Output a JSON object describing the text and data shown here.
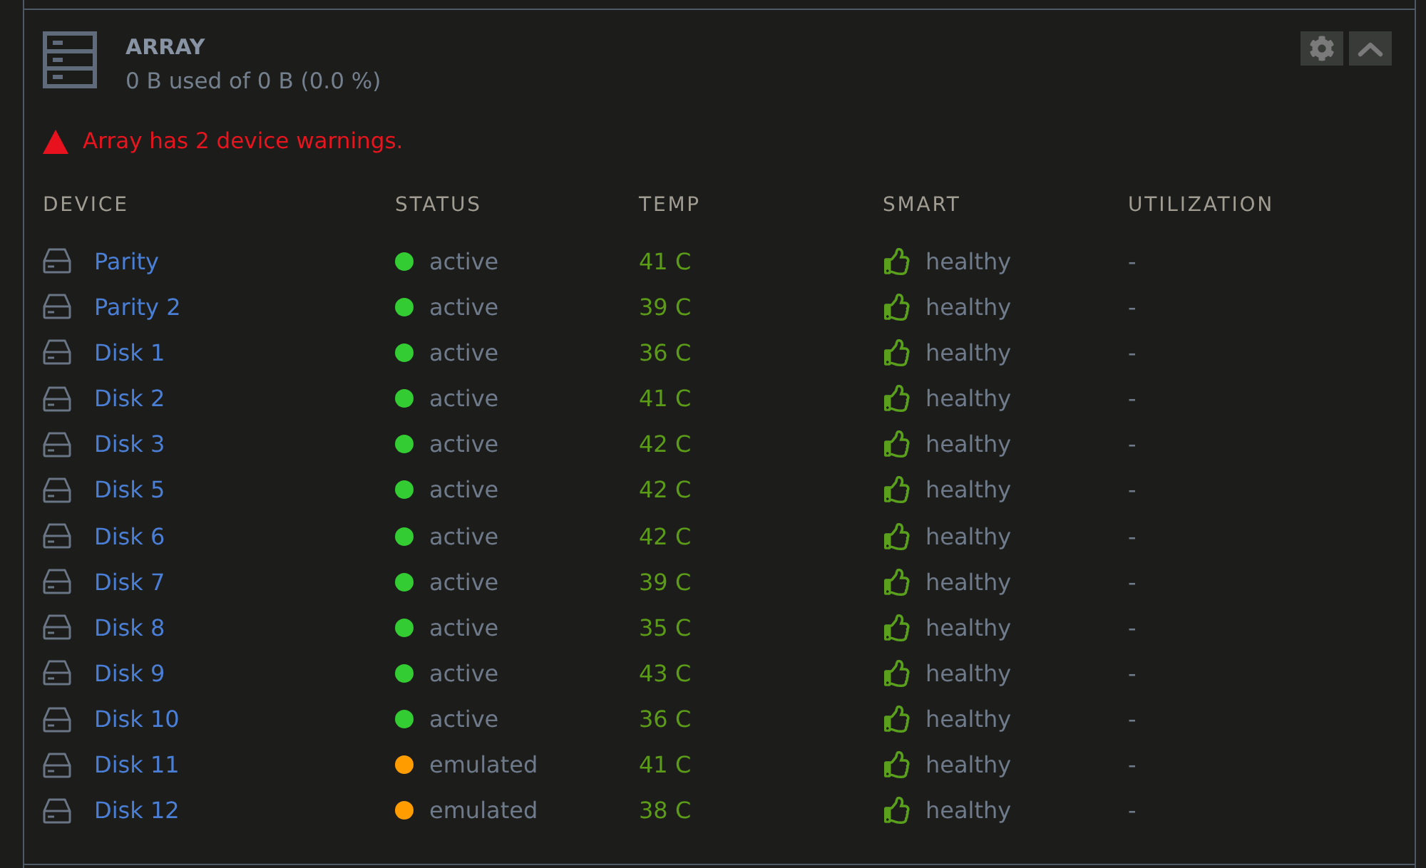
{
  "panel": {
    "title": "ARRAY",
    "usage": "0 B used of 0 B (0.0 %)",
    "warning": "Array has 2 device warnings."
  },
  "table": {
    "columns": [
      "DEVICE",
      "STATUS",
      "TEMP",
      "SMART",
      "UTILIZATION"
    ],
    "rows": [
      {
        "device": "Parity",
        "status": "active",
        "color": "#33cc33",
        "temp": "41 C",
        "smart": "healthy",
        "utilization": "-"
      },
      {
        "device": "Parity 2",
        "status": "active",
        "color": "#33cc33",
        "temp": "39 C",
        "smart": "healthy",
        "utilization": "-"
      },
      {
        "device": "Disk 1",
        "status": "active",
        "color": "#33cc33",
        "temp": "36 C",
        "smart": "healthy",
        "utilization": "-"
      },
      {
        "device": "Disk 2",
        "status": "active",
        "color": "#33cc33",
        "temp": "41 C",
        "smart": "healthy",
        "utilization": "-"
      },
      {
        "device": "Disk 3",
        "status": "active",
        "color": "#33cc33",
        "temp": "42 C",
        "smart": "healthy",
        "utilization": "-"
      },
      {
        "device": "Disk 5",
        "status": "active",
        "color": "#33cc33",
        "temp": "42 C",
        "smart": "healthy",
        "utilization": "-"
      },
      {
        "device": "Disk 6",
        "status": "active",
        "color": "#33cc33",
        "temp": "42 C",
        "smart": "healthy",
        "utilization": "-"
      },
      {
        "device": "Disk 7",
        "status": "active",
        "color": "#33cc33",
        "temp": "39 C",
        "smart": "healthy",
        "utilization": "-"
      },
      {
        "device": "Disk 8",
        "status": "active",
        "color": "#33cc33",
        "temp": "35 C",
        "smart": "healthy",
        "utilization": "-"
      },
      {
        "device": "Disk 9",
        "status": "active",
        "color": "#33cc33",
        "temp": "43 C",
        "smart": "healthy",
        "utilization": "-"
      },
      {
        "device": "Disk 10",
        "status": "active",
        "color": "#33cc33",
        "temp": "36 C",
        "smart": "healthy",
        "utilization": "-"
      },
      {
        "device": "Disk 11",
        "status": "emulated",
        "color": "#ff9c00",
        "temp": "41 C",
        "smart": "healthy",
        "utilization": "-"
      },
      {
        "device": "Disk 12",
        "status": "emulated",
        "color": "#ff9c00",
        "temp": "38 C",
        "smart": "healthy",
        "utilization": "-"
      }
    ]
  }
}
